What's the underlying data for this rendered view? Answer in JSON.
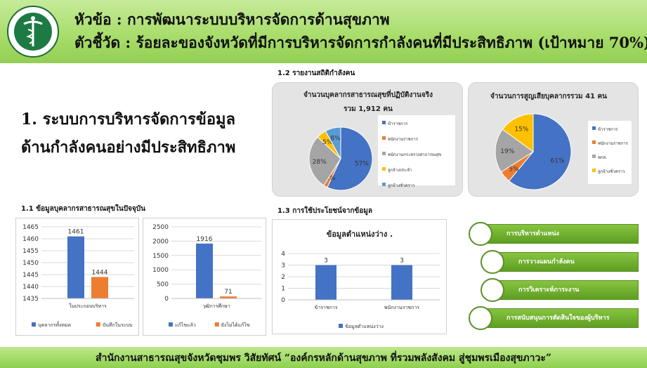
{
  "header": {
    "line1": "หัวข้อ : การพัฒนาระบบบริหารจัดการด้านสุขภาพ",
    "line2": "ตัวชี้วัด : ร้อยละของจังหวัดที่มีการบริหารจัดการกำลังคนที่มีประสิทธิภาพ (เป้าหมาย 70%)",
    "logo_icon": "ministry-of-public-health-seal"
  },
  "main_heading": {
    "line1": "1. ระบบการบริหารจัดการข้อมูล",
    "line2": "ด้านกำลังคนอย่างมีประสิทธิภาพ"
  },
  "sections": {
    "s11": "1.1 ข้อมูลบุคลากรสาธารณสุขในปัจจุบัน",
    "s12": "1.2 รายงานสถิติกำลังคน",
    "s13": "1.3 การใช้ประโยชน์จากข้อมูล"
  },
  "menu": {
    "items": [
      {
        "label": "การบริหารตำแหน่ง"
      },
      {
        "label": "การวางแผนกำลังคน"
      },
      {
        "label": "การวิเคราะห์ภาระงาน"
      },
      {
        "label": "การสนับสนุนการตัดสินใจของผู้บริหาร"
      }
    ]
  },
  "footer": {
    "text": "สำนักงานสาธารณสุขจังหวัดชุมพร    วิสัยทัศน์    “องค์กรหลักด้านสุขภาพ ที่รวมพลังสังคม สู่ชุมพรเมืองสุขภาวะ”"
  },
  "colors": {
    "blue": "#4472c4",
    "orange": "#ed7d31",
    "gray": "#a5a5a5",
    "yellow": "#ffc000",
    "lightblue": "#5b9bd5"
  },
  "chart_data": [
    {
      "id": "bar1",
      "type": "bar",
      "title": "",
      "categories": [
        "ในประกอบบริหาร"
      ],
      "series": [
        {
          "name": "บุคลากรทั้งหมด",
          "values": [
            1461
          ]
        },
        {
          "name": "บันทึกในระบบ",
          "values": [
            1444
          ]
        }
      ],
      "ylim": [
        1435,
        1465
      ],
      "yticks": [
        1435,
        1440,
        1445,
        1450,
        1455,
        1460,
        1465
      ],
      "grid": true,
      "legend": "bottom"
    },
    {
      "id": "bar2",
      "type": "bar",
      "title": "",
      "categories": [
        "วุฒิการศึกษา"
      ],
      "series": [
        {
          "name": "แก้ไขแล้ว",
          "values": [
            1916
          ]
        },
        {
          "name": "ยังไม่ได้แก้ไข",
          "values": [
            71
          ]
        }
      ],
      "ylim": [
        0,
        2500
      ],
      "yticks": [
        0,
        500,
        1000,
        1500,
        2000,
        2500
      ],
      "grid": true,
      "legend": "bottom"
    },
    {
      "id": "bar3",
      "type": "bar",
      "title": "ข้อมูลตำแหน่งว่าง .",
      "categories": [
        "ข้าราชการ",
        "พนักงานราชการ"
      ],
      "series": [
        {
          "name": "ข้อมูลตำแหน่งว่าง",
          "values": [
            3,
            3
          ]
        }
      ],
      "ylim": [
        0,
        4
      ],
      "yticks": [
        0,
        1,
        2,
        3,
        4
      ],
      "grid": true,
      "legend": "bottom"
    },
    {
      "id": "pie1",
      "type": "pie",
      "title": "จำนวนบุคลากรสาธารณสุขที่ปฏิบัติงานจริง",
      "subtitle": "รวม 1,912 คน",
      "labels": [
        "ข้าราชการ",
        "พนักงานราชการ",
        "พนักงานกระทรวงสาธารณสุข",
        "ลูกจ้างประจำ",
        "ลูกจ้างชั่วคราว"
      ],
      "values": [
        57,
        2,
        28,
        5,
        8
      ],
      "value_labels": [
        "57%",
        "2%",
        "28%",
        "5%",
        "8%"
      ],
      "legend": "right"
    },
    {
      "id": "pie2",
      "type": "pie",
      "title": "จำนวนการสูญเสียบุคลากรรวม 41  คน",
      "labels": [
        "ข้าราชการ",
        "พนักงานราชการ",
        "พกส.",
        "ลูกจ้างชั่วคราว"
      ],
      "values": [
        61,
        5,
        19,
        15
      ],
      "value_labels": [
        "61%",
        "5%",
        "19%",
        "15%"
      ],
      "legend": "right"
    }
  ]
}
